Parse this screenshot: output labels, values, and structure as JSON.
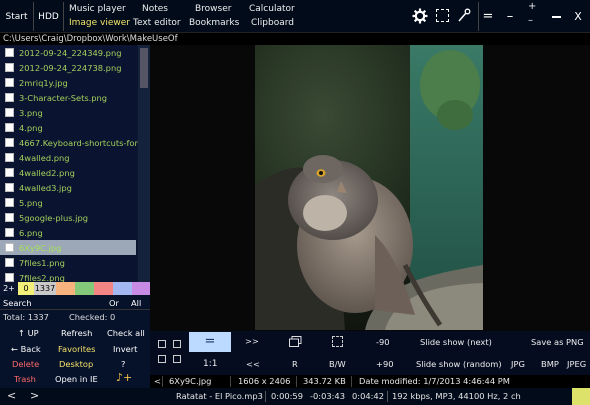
{
  "topbar": {
    "start": "Start",
    "hdd": "HDD",
    "menu": [
      {
        "label": "Music player",
        "active": false
      },
      {
        "label": "Notes",
        "active": false
      },
      {
        "label": "Browser",
        "active": false
      },
      {
        "label": "Calculator",
        "active": false
      },
      {
        "label": "Image viewer",
        "active": true
      },
      {
        "label": "Text editor",
        "active": false
      },
      {
        "label": "Bookmarks",
        "active": false
      },
      {
        "label": "Clipboard",
        "active": false
      }
    ],
    "window": {
      "equals": "=",
      "minus": "–",
      "plusminus_plus": "+",
      "plusminus_minus": "–",
      "close": "X"
    }
  },
  "path": "C:\\Users\\Craig\\Dropbox\\Work\\MakeUseOf",
  "files": [
    "2012-09-24_224349.png",
    "2012-09-24_224738.png",
    "2mriq1y.jpg",
    "3-Character-Sets.png",
    "3.png",
    "4.png",
    "4667.Keyboard-shortcuts-for-...",
    "4walled.png",
    "4walled2.png",
    "4walled3.jpg",
    "5.png",
    "5google-plus.jpg",
    "6.png",
    "6Xy9C.jpg",
    "7files1.png",
    "7files2.png"
  ],
  "selected_index": 13,
  "colorstrip": {
    "plus": "2+",
    "zero": "0",
    "count": "1337"
  },
  "leftpanel": {
    "search": "Search",
    "or": "Or",
    "all": "All",
    "total": "Total: 1337",
    "checked": "Checked: 0",
    "up": "↑ UP",
    "refresh": "Refresh",
    "check_all": "Check all",
    "back": "← Back",
    "favorites": "Favorites",
    "invert": "Invert",
    "delete": "Delete",
    "desktop": "Desktop",
    "question": "?",
    "trash": "Trash",
    "open_ie": "Open in IE",
    "note": "♪+"
  },
  "controls": {
    "equals": "=",
    "ffwd": ">>",
    "minus90": "-90",
    "slideshow_next": "Slide show (next)",
    "save_png": "Save as PNG",
    "one_one": "1:1",
    "rew": "<<",
    "r": "R",
    "bw": "B/W",
    "plus90": "+90",
    "slideshow_random": "Slide show (random)",
    "jpg": "JPG",
    "bmp": "BMP",
    "jpeg": "JPEG"
  },
  "info": {
    "prev": "<",
    "filename": "6Xy9C.jpg",
    "dimensions": "1606 x 2406",
    "size": "343.72 KB",
    "modified": "Date modified: 1/7/2013 4:46:44 PM"
  },
  "music": {
    "left": "<",
    "right": ">",
    "track": "Ratatat - El Pico.mp3",
    "elapsed": "0:00:59",
    "remaining": "-0:03:43",
    "total": "0:04:42",
    "format": "192 kbps, MP3, 44100 Hz, 2 ch"
  },
  "colors": {
    "file_green": "#a6d05d",
    "active_yellow": "#f2e36a",
    "delete_red": "#ff6a6a",
    "favorites_yellow": "#f6e36a"
  }
}
